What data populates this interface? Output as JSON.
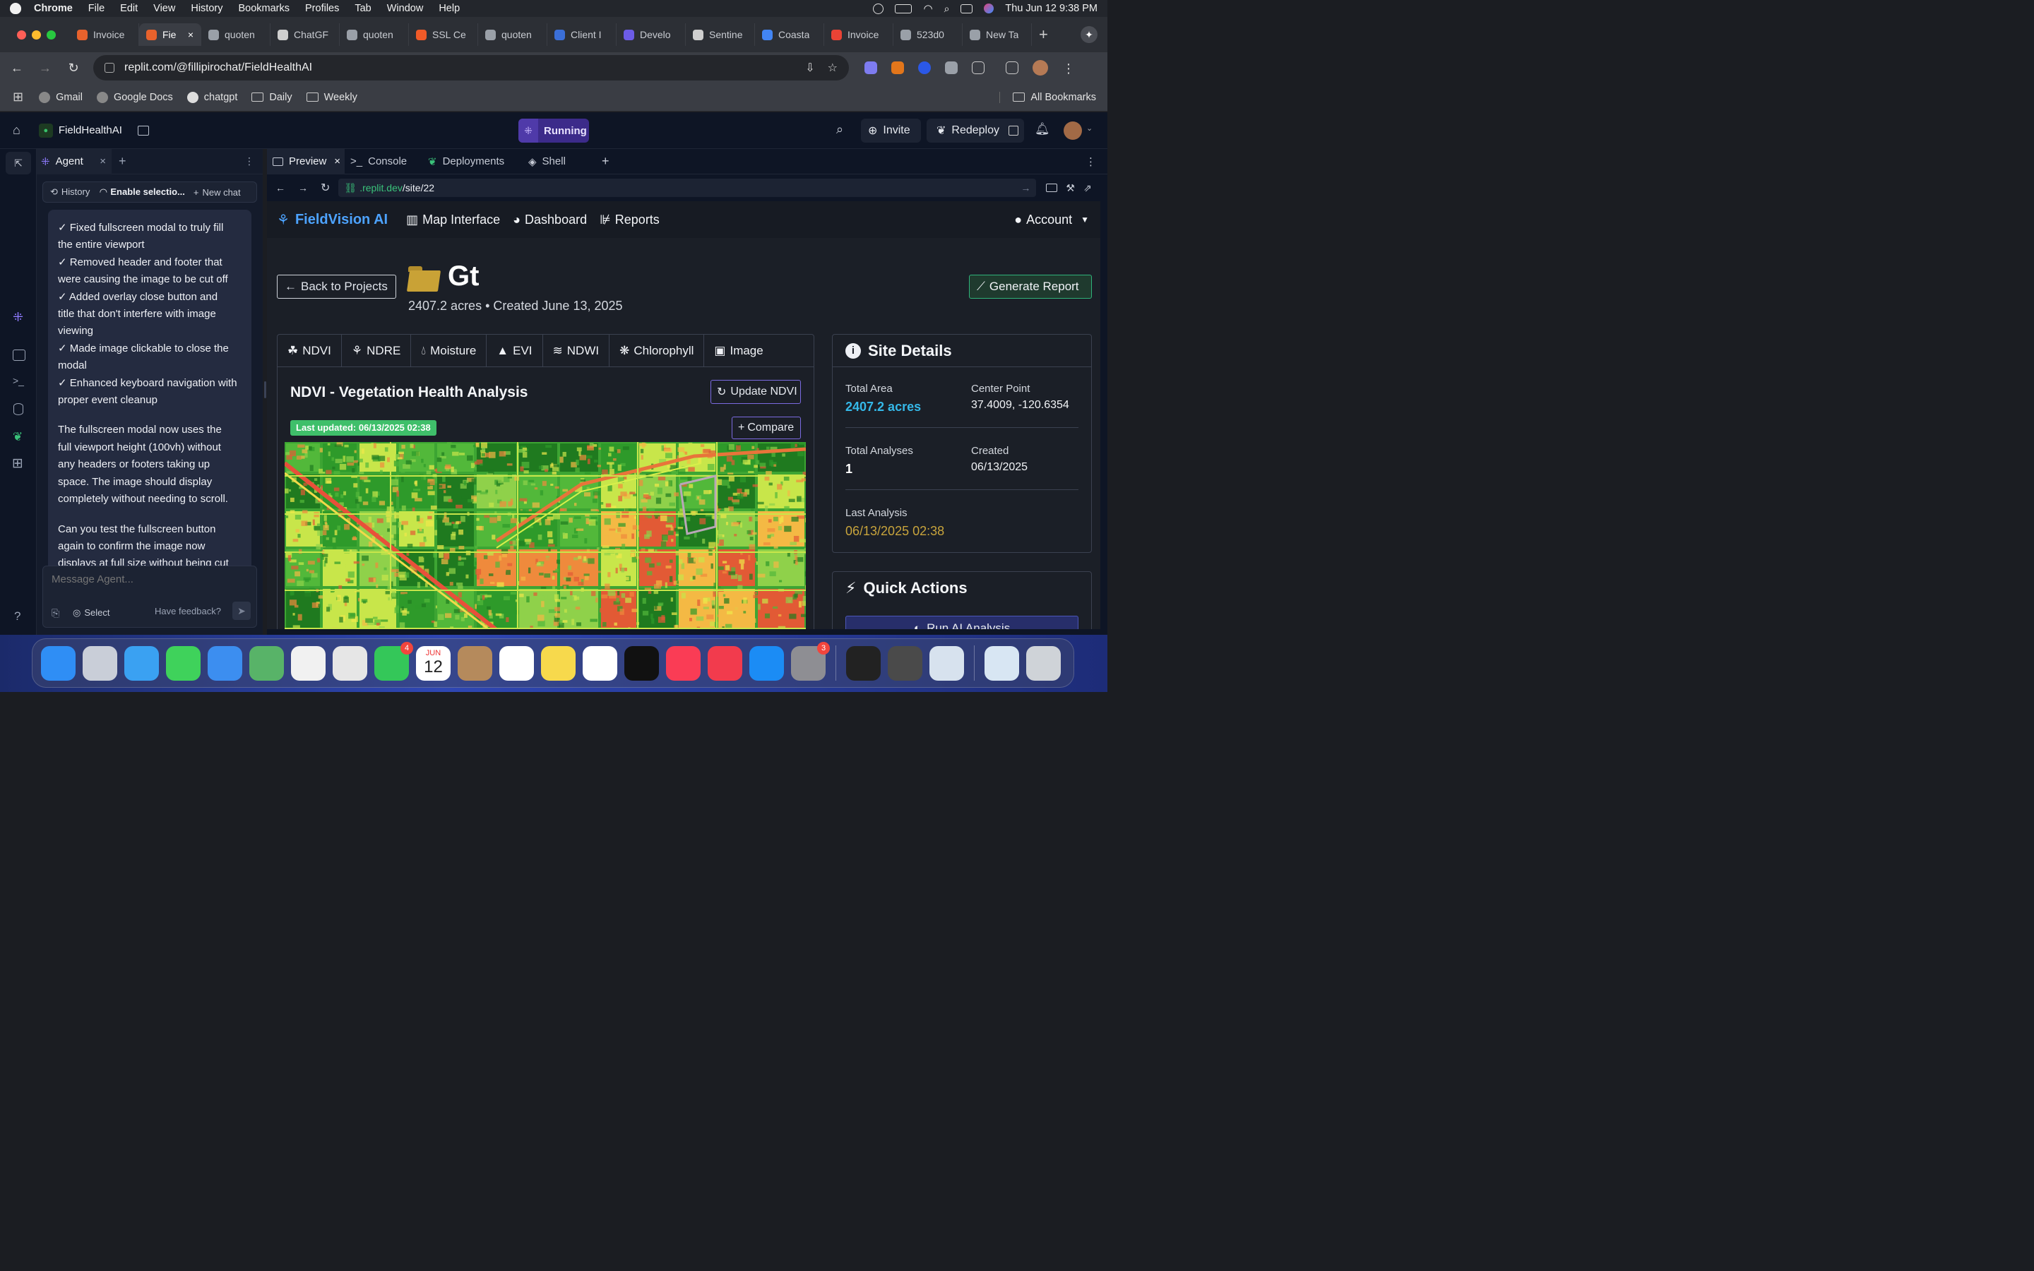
{
  "menubar": {
    "app": "Chrome",
    "items": [
      "File",
      "Edit",
      "View",
      "History",
      "Bookmarks",
      "Profiles",
      "Tab",
      "Window",
      "Help"
    ],
    "clock": "Thu Jun 12  9:38 PM"
  },
  "tabs": [
    {
      "label": "Invoice",
      "color": "#e8622c"
    },
    {
      "label": "Fie",
      "color": "#e8622c",
      "active": true
    },
    {
      "label": "quoten",
      "color": "#9aa0a8"
    },
    {
      "label": "ChatGF",
      "color": "#cfcfcf"
    },
    {
      "label": "quoten",
      "color": "#9aa0a8"
    },
    {
      "label": "SSL Ce",
      "color": "#f05a28"
    },
    {
      "label": "quoten",
      "color": "#9aa0a8"
    },
    {
      "label": "Client I",
      "color": "#3b6fd8"
    },
    {
      "label": "Develo",
      "color": "#6c5ce7"
    },
    {
      "label": "Sentine",
      "color": "#cfcfcf"
    },
    {
      "label": "Coasta",
      "color": "#4285f4"
    },
    {
      "label": "Invoice",
      "color": "#ea4335"
    },
    {
      "label": "523d0",
      "color": "#9aa0a8"
    },
    {
      "label": "New Ta",
      "color": "#9aa0a8"
    }
  ],
  "address": "replit.com/@fillipirochat/FieldHealthAI",
  "bookmarks": [
    "Gmail",
    "Google Docs",
    "chatgpt",
    "Daily",
    "Weekly"
  ],
  "all_bookmarks": "All Bookmarks",
  "replit": {
    "project": "FieldHealthAI",
    "status": "Running",
    "invite": "Invite",
    "redeploy": "Redeploy"
  },
  "agent": {
    "tab": "Agent",
    "history": "History",
    "enable_selection": "Enable selectio...",
    "new_chat": "New chat",
    "lines_a": [
      "✓ Fixed fullscreen modal to truly fill",
      "the entire viewport",
      "✓ Removed header and footer that",
      "were causing the image to be cut off",
      "✓ Added overlay close button and",
      "title that don't interfere with image",
      "viewing",
      "✓ Made image clickable to close the",
      "modal",
      "✓ Enhanced keyboard navigation with",
      "proper event cleanup"
    ],
    "lines_b": [
      "The fullscreen modal now uses the",
      "full viewport height (100vh) without",
      "any headers or footers taking up",
      "space. The image should display",
      "completely without needing to scroll."
    ],
    "lines_c": [
      "Can you test the fullscreen button",
      "again to confirm the image now",
      "displays at full size without being cut"
    ],
    "placeholder": "Message Agent...",
    "select": "Select",
    "feedback": "Have feedback?"
  },
  "workspace_tabs": [
    "Preview",
    "Console",
    "Deployments",
    "Shell"
  ],
  "preview_url_host": ".replit.dev",
  "preview_url_path": "/site/22",
  "app": {
    "brand": "FieldVision AI",
    "nav": [
      "Map Interface",
      "Dashboard",
      "Reports"
    ],
    "account": "Account",
    "back": "Back to Projects",
    "project_title": "Gt",
    "project_sub": "2407.2 acres • Created June 13, 2025",
    "generate": "Generate Report",
    "index_tabs": [
      "NDVI",
      "NDRE",
      "Moisture",
      "EVI",
      "NDWI",
      "Chlorophyll",
      "Image"
    ],
    "analysis_title": "NDVI - Vegetation Health Analysis",
    "update_btn": "Update NDVI",
    "last_updated": "Last updated: 06/13/2025 02:38",
    "compare": "Compare",
    "site_details": {
      "title": "Site Details",
      "total_area_label": "Total Area",
      "total_area": "2407.2 acres",
      "center_label": "Center Point",
      "center": "37.4009, -120.6354",
      "analyses_label": "Total Analyses",
      "analyses": "1",
      "created_label": "Created",
      "created": "06/13/2025",
      "last_label": "Last Analysis",
      "last": "06/13/2025 02:38"
    },
    "quick_actions": "Quick Actions",
    "run_ai": "Run AI Analysis"
  },
  "dock": {
    "calendar_month": "JUN",
    "calendar_day": "12",
    "facetime_badge": "4",
    "settings_badge": "3"
  }
}
